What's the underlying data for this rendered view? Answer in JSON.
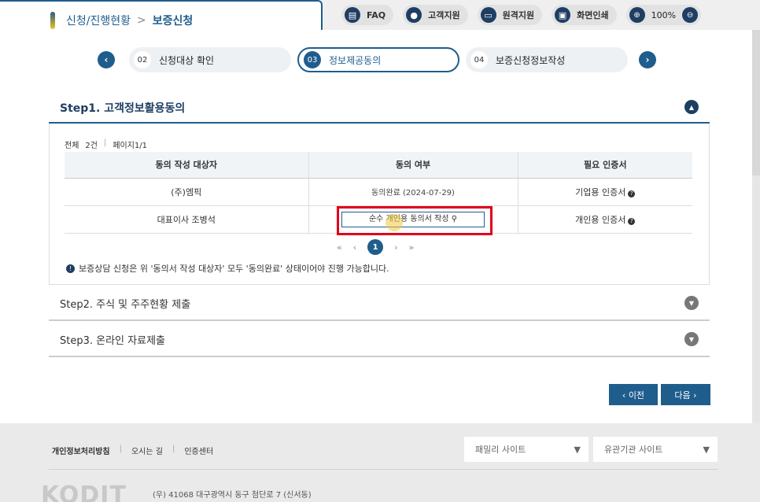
{
  "breadcrumb": {
    "parent": "신청/진행현황",
    "separator": ">",
    "current": "보증신청"
  },
  "toolbar": {
    "faq": "FAQ",
    "customer": "고객지원",
    "remote": "원격지원",
    "print": "화면인쇄",
    "zoom_level": "100%"
  },
  "icons": {
    "faq": "chat-icon",
    "customer": "person-icon",
    "remote": "monitor-icon",
    "print": "printer-icon",
    "zoom_in": "zoom-in-icon",
    "zoom_out": "zoom-out-icon"
  },
  "stepper": {
    "prev_arrow": "‹",
    "next_arrow": "›",
    "steps": [
      {
        "num": "02",
        "label": "신청대상 확인"
      },
      {
        "num": "03",
        "label": "정보제공동의"
      },
      {
        "num": "04",
        "label": "보증신청정보작성"
      }
    ]
  },
  "step1": {
    "title": "Step1. 고객정보활용동의",
    "count": {
      "total_label": "전체",
      "total": "2건",
      "page": "페이지1/1"
    },
    "table": {
      "headers": [
        "동의 작성 대상자",
        "동의 여부",
        "필요 인증서"
      ],
      "rows": [
        {
          "target": "(주)엠픽",
          "status": "동의완료 (2024-07-29)",
          "cert": "기업용 인증서"
        },
        {
          "target": "대표이사 조병석",
          "status": "순수 개인용 동의서 작성",
          "cert": "개인용 인증서"
        }
      ]
    },
    "pager": {
      "first": "«",
      "prev": "‹",
      "current": "1",
      "next": "›",
      "last": "»"
    },
    "notice": "보증상담 신청은 위 '동의서 작성 대상자' 모두 '동의완료' 상태이어야 진행 가능합니다."
  },
  "step2": {
    "title": "Step2. 주식 및 주주현황 제출"
  },
  "step3": {
    "title": "Step3. 온라인 자료제출"
  },
  "buttons": {
    "prev": "‹ 이전",
    "next": "다음 ›"
  },
  "footer": {
    "privacy": "개인정보처리방침",
    "directions": "오시는 길",
    "cert_center": "인증센터",
    "family_site": "패밀리 사이트",
    "related_site": "유관기관 사이트",
    "logo": "KODIT",
    "address": "(우) 41068 대구광역시 동구 첨단로 7 (신서동)"
  },
  "colors": {
    "primary": "#1f5d8c",
    "dark": "#1f3e63",
    "highlight": "#e0001a"
  }
}
